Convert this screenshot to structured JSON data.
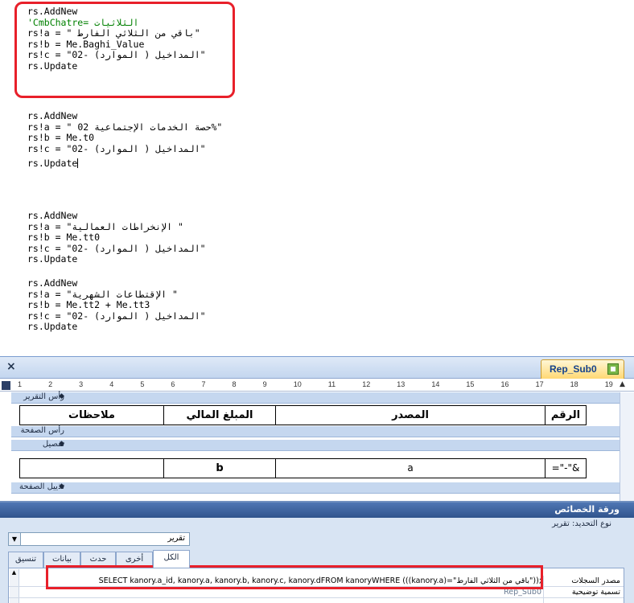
{
  "code_blocks": [
    {
      "lines": [
        {
          "text": "rs.AddNew",
          "comment": false
        },
        {
          "text": "'CmbChatre= الثلاثيات",
          "comment": true
        },
        {
          "text": "rs!a = \" باقي من الثلاثي الفارط\"",
          "comment": false
        },
        {
          "text": "rs!b = Me.Baghi_Value",
          "comment": false
        },
        {
          "text": "rs!c = \"02- المداخيل ( الموارد)\"",
          "comment": false
        },
        {
          "text": "rs.Update",
          "comment": false
        }
      ]
    },
    {
      "lines": [
        {
          "text": "rs.AddNew",
          "comment": false
        },
        {
          "text": "rs!a = \" حصة الخدمات الإجتماعية 02%\"",
          "comment": false
        },
        {
          "text": "rs!b = Me.t0",
          "comment": false
        },
        {
          "text": "rs!c = \"02- المداخيل ( الموارد)\"",
          "comment": false
        },
        {
          "text": "rs.Update",
          "comment": false
        }
      ]
    },
    {
      "lines": [
        {
          "text": "rs.AddNew",
          "comment": false
        },
        {
          "text": "rs!a = \"الإنخراطات العمالية \"",
          "comment": false
        },
        {
          "text": "rs!b = Me.tt0",
          "comment": false
        },
        {
          "text": "rs!c = \"02- المداخيل ( الموارد)\"",
          "comment": false
        },
        {
          "text": "rs.Update",
          "comment": false
        }
      ]
    },
    {
      "lines": [
        {
          "text": "rs.AddNew",
          "comment": false
        },
        {
          "text": "rs!a = \"الإقتطاعات الشهرية \"",
          "comment": false
        },
        {
          "text": "rs!b = Me.tt2 + Me.tt3",
          "comment": false
        },
        {
          "text": "rs!c = \"02- المداخيل ( الموارد)\"",
          "comment": false
        },
        {
          "text": "rs.Update",
          "comment": false
        }
      ]
    }
  ],
  "report_window": {
    "close_glyph": "×",
    "tab_title": "Rep_Sub0",
    "ruler_marks": [
      "1",
      "2",
      "3",
      "4",
      "5",
      "6",
      "7",
      "8",
      "9",
      "10",
      "11",
      "12",
      "13",
      "14",
      "15",
      "16",
      "17",
      "18",
      "19"
    ],
    "sections": {
      "report_header": "رأس التقرير",
      "page_header": "رأس الصفحة",
      "detail": "تفصيل",
      "page_footer": "تذييل الصفحة"
    },
    "header_row": {
      "notes": "ملاحظات",
      "amount": "المبلغ المالي",
      "source": "المصدر",
      "number": "الرقم"
    },
    "detail_row": {
      "notes": "",
      "amount": "b",
      "source": "a",
      "number": "=\"-\"&"
    }
  },
  "property_sheet": {
    "title": "ورقة الخصائص",
    "selection_type": "نوع التحديد: تقرير",
    "selector_value": "تقرير",
    "tabs": [
      "الكل",
      "أخرى",
      "حدث",
      "بيانات",
      "تنسيق"
    ],
    "rows": [
      {
        "name": "مصدر السجلات",
        "value": "SELECT kanory.a_id, kanory.a, kanory.b, kanory.c, kanory.dFROM kanoryWHERE (((kanory.a)=\"باقي من الثلاثي الفارط\"));"
      },
      {
        "name": "تسمية توضيحية",
        "value": "Rep_Sub0"
      },
      {
        "name": "",
        "value": ""
      }
    ]
  },
  "colors": {
    "highlight": "#e8202a",
    "comment": "#008000",
    "access_blue": "#30538c"
  }
}
